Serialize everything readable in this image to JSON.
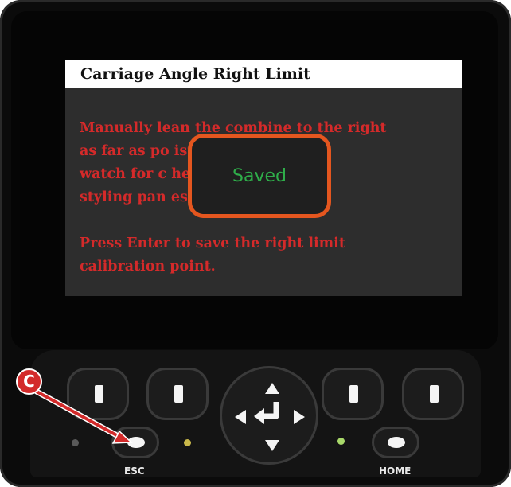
{
  "screen": {
    "title": "Carriage Angle Right Limit",
    "lines": [
      "Manually lean the combine to the right",
      "as far as po                  istant",
      "watch for c                   he ladder or",
      "styling pan                   es",
      "",
      "Press Enter to save the right limit",
      "calibration point."
    ]
  },
  "toast": {
    "text": "Saved"
  },
  "keypad": {
    "esc_label": "ESC",
    "home_label": "HOME"
  },
  "callout": {
    "letter": "C"
  },
  "colors": {
    "instruction_text": "#d42a2a",
    "toast_border": "#e4561f",
    "toast_text": "#2fae4a",
    "led_amber": "#c9b84a",
    "led_green": "#a8d86a",
    "callout": "#d32a2a"
  },
  "icons": [
    "softkey-bar-icon",
    "arrow-up-icon",
    "arrow-down-icon",
    "arrow-left-icon",
    "arrow-right-icon",
    "enter-icon"
  ]
}
